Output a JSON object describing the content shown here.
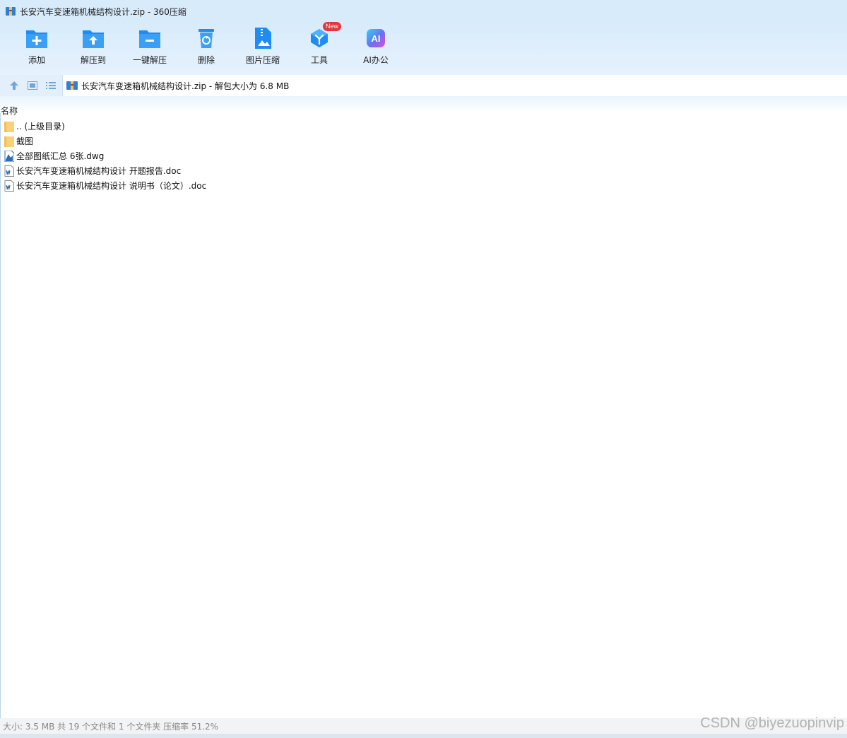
{
  "window": {
    "title": "长安汽车变速箱机械结构设计.zip - 360压缩"
  },
  "toolbar": {
    "items": [
      {
        "label": "添加",
        "icon": "add-folder-icon"
      },
      {
        "label": "解压到",
        "icon": "extract-to-icon"
      },
      {
        "label": "一键解压",
        "icon": "one-click-extract-icon"
      },
      {
        "label": "删除",
        "icon": "recycle-bin-icon"
      },
      {
        "label": "图片压缩",
        "icon": "image-compress-icon"
      },
      {
        "label": "工具",
        "icon": "tools-cube-icon",
        "badge": "New"
      },
      {
        "label": "AI办公",
        "icon": "ai-office-icon",
        "badge_text": "AI"
      }
    ]
  },
  "address": {
    "path": "长安汽车变速箱机械结构设计.zip - 解包大小为 6.8 MB"
  },
  "list": {
    "column_name": "名称",
    "files": [
      {
        "name": ".. (上级目录)",
        "type": "parent-folder"
      },
      {
        "name": "截图",
        "type": "folder"
      },
      {
        "name": "全部图纸汇总 6张.dwg",
        "type": "dwg"
      },
      {
        "name": "长安汽车变速箱机械结构设计 开题报告.doc",
        "type": "doc"
      },
      {
        "name": "长安汽车变速箱机械结构设计 说明书（论文）.doc",
        "type": "doc"
      }
    ]
  },
  "status": {
    "text": "大小: 3.5 MB 共 19 个文件和 1 个文件夹 压缩率 51.2%"
  },
  "watermark": "CSDN @biyezuopinvip",
  "colors": {
    "accent_blue": "#1e8cf0",
    "toolbar_bg": "#d8ebfb",
    "folder_yellow": "#f7d27a",
    "new_badge_red": "#e8343c"
  }
}
